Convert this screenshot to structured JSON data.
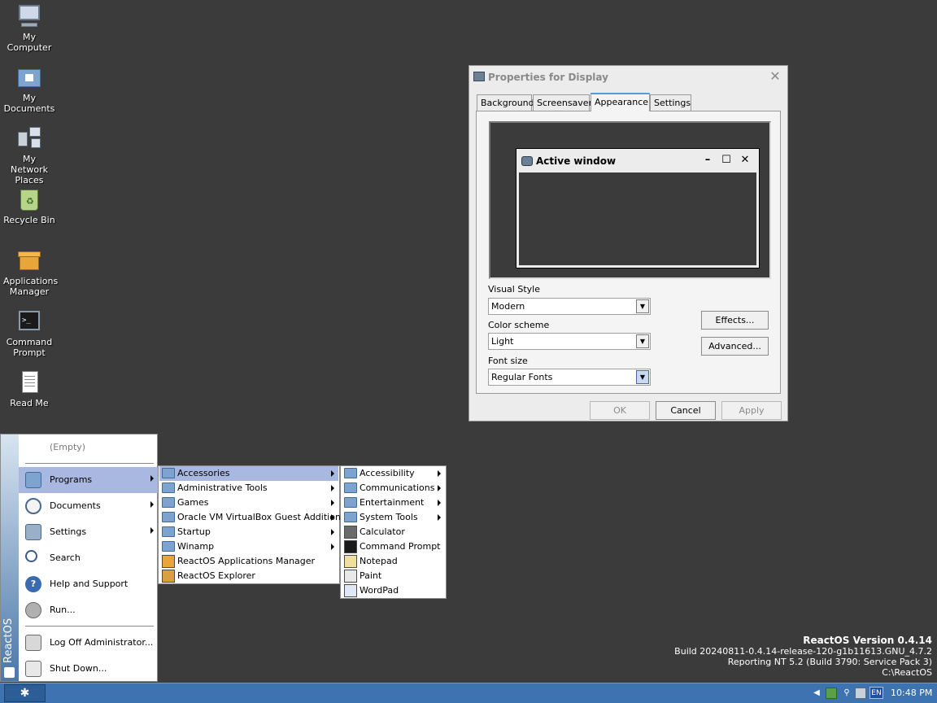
{
  "desktop": {
    "icons": [
      {
        "label": "My Computer",
        "icon": "computer-icon"
      },
      {
        "label": "My Documents",
        "icon": "documents-folder-icon"
      },
      {
        "label": "My Network Places",
        "icon": "network-icon"
      },
      {
        "label": "Recycle Bin",
        "icon": "recycle-bin-icon"
      },
      {
        "label": "Applications Manager",
        "icon": "applications-manager-icon"
      },
      {
        "label": "Command Prompt",
        "icon": "command-prompt-icon"
      },
      {
        "label": "Read Me",
        "icon": "readme-icon"
      }
    ]
  },
  "dialog": {
    "title": "Properties for Display",
    "close": "✕",
    "tabs": [
      "Background",
      "Screensaver",
      "Appearance",
      "Settings"
    ],
    "active_tab": "Appearance",
    "preview": {
      "window_title": "Active window",
      "min": "–",
      "max": "☐",
      "close": "✕"
    },
    "visual_style_label": "Visual Style",
    "visual_style_value": "Modern",
    "color_scheme_label": "Color scheme",
    "color_scheme_value": "Light",
    "font_size_label": "Font size",
    "font_size_value": "Regular Fonts",
    "effects_button": "Effects...",
    "advanced_button": "Advanced...",
    "ok_button": "OK",
    "cancel_button": "Cancel",
    "apply_button": "Apply"
  },
  "start_menu": {
    "brand": "ReactOS",
    "empty": "(Empty)",
    "items": [
      {
        "label": "Programs",
        "icon": "programs-icon",
        "submenu": true
      },
      {
        "label": "Documents",
        "icon": "documents-icon",
        "submenu": true
      },
      {
        "label": "Settings",
        "icon": "settings-icon",
        "submenu": true
      },
      {
        "label": "Search",
        "icon": "search-icon",
        "submenu": false
      },
      {
        "label": "Help and Support",
        "icon": "help-icon",
        "submenu": false
      },
      {
        "label": "Run...",
        "icon": "run-icon",
        "submenu": false
      }
    ],
    "logoff": "Log Off Administrator...",
    "shutdown": "Shut Down..."
  },
  "programs_menu": {
    "items": [
      {
        "label": "Accessories",
        "type": "folder",
        "submenu": true
      },
      {
        "label": "Administrative Tools",
        "type": "folder",
        "submenu": true
      },
      {
        "label": "Games",
        "type": "folder",
        "submenu": true
      },
      {
        "label": "Oracle VM VirtualBox Guest Additions",
        "type": "folder",
        "submenu": true
      },
      {
        "label": "Startup",
        "type": "folder",
        "submenu": true
      },
      {
        "label": "Winamp",
        "type": "folder",
        "submenu": true
      },
      {
        "label": "ReactOS Applications Manager",
        "type": "app",
        "submenu": false
      },
      {
        "label": "ReactOS Explorer",
        "type": "app",
        "submenu": false
      }
    ]
  },
  "accessories_menu": {
    "items": [
      {
        "label": "Accessibility",
        "type": "folder",
        "submenu": true
      },
      {
        "label": "Communications",
        "type": "folder",
        "submenu": true
      },
      {
        "label": "Entertainment",
        "type": "folder",
        "submenu": true
      },
      {
        "label": "System Tools",
        "type": "folder",
        "submenu": true
      },
      {
        "label": "Calculator",
        "type": "app",
        "submenu": false
      },
      {
        "label": "Command Prompt",
        "type": "app",
        "submenu": false
      },
      {
        "label": "Notepad",
        "type": "app",
        "submenu": false
      },
      {
        "label": "Paint",
        "type": "app",
        "submenu": false
      },
      {
        "label": "WordPad",
        "type": "app",
        "submenu": false
      }
    ]
  },
  "watermark": {
    "title": "ReactOS Version 0.4.14",
    "build": "Build 20240811-0.4.14-release-120-g1b11613.GNU_4.7.2",
    "reporting": "Reporting NT 5.2 (Build 3790: Service Pack 3)",
    "path": "C:\\ReactOS"
  },
  "taskbar": {
    "start_glyph": "✱",
    "tray": {
      "language": "EN",
      "clock": "10:48 PM"
    }
  },
  "colors": {
    "desktop": "#3b3b3b",
    "taskbar": "#3c73b0",
    "menu_highlight": "#a8b8e0",
    "tab_accent": "#5b9bd5"
  }
}
